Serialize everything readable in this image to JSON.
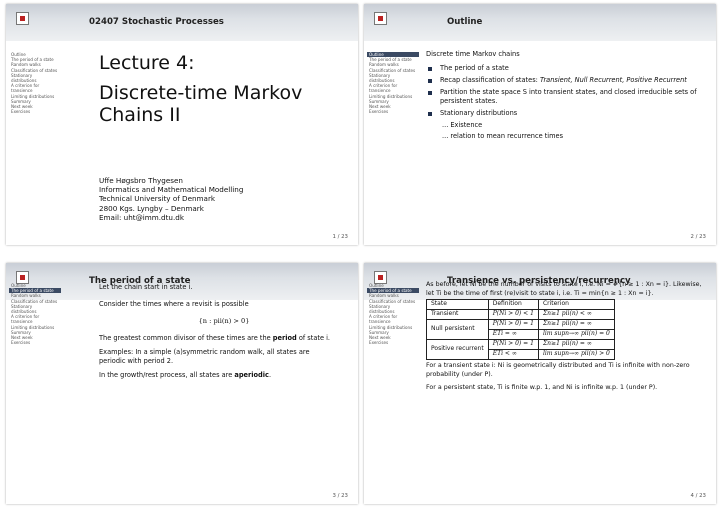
{
  "slide1": {
    "header_title": "02407 Stochastic Processes",
    "nav": [
      "Outline",
      "The period of a state",
      "Random walks",
      "Classification of states",
      "Stationary",
      "distributions",
      "A criterion for",
      "transience",
      "Limiting distributions",
      "Summary",
      "Next week",
      "Exercises"
    ],
    "title_line1": "Lecture 4:",
    "title_line2": "Discrete-time Markov Chains II",
    "author": "Uffe Høgsbro Thygesen",
    "affiliation": "Informatics and Mathematical Modelling",
    "university": "Technical University of Denmark",
    "address": "2800 Kgs. Lyngby – Denmark",
    "email": "Email: uht@imm.dtu.dk",
    "page": "1 / 23"
  },
  "slide2": {
    "header_title": "Outline",
    "nav_current": "Outline",
    "nav": [
      "The period of a state",
      "Random walks",
      "Classification of states",
      "Stationary",
      "distributions",
      "A criterion for",
      "transience",
      "Limiting distributions",
      "Summary",
      "Next week",
      "Exercises"
    ],
    "heading": "Discrete time Markov chains",
    "bullet1": "The period of a state",
    "bullet2_prefix": "Recap classification of states: ",
    "bullet2_italic": "Transient, Null Recurrent, Positive Recurrent",
    "bullet3": "Partition the state space S into transient states, and closed irreducible sets of persistent states.",
    "bullet4": "Stationary distributions",
    "sub1": "... Existence",
    "sub2": "... relation to mean recurrence times",
    "page": "2 / 23"
  },
  "slide3": {
    "header_title": "The period of a state",
    "nav_before": [
      "Outline"
    ],
    "nav_current": "The period of a state",
    "nav": [
      "Random walks",
      "Classification of states",
      "Stationary",
      "distributions",
      "A criterion for",
      "transience",
      "Limiting distributions",
      "Summary",
      "Next week",
      "Exercises"
    ],
    "p1": "Let the chain start in state i.",
    "p2": "Consider the times where a revisit is possible",
    "formula": "{n : pii(n) > 0}",
    "p3_prefix": "The greatest common divisor of these times are the ",
    "p3_bold": "period",
    "p3_suffix": " of state i.",
    "p4": "Examples: In a simple (a)symmetric random walk, all states are periodic with period 2.",
    "p5_prefix": "In the growth/rest process, all states are ",
    "p5_bold": "aperiodic",
    "p5_suffix": ".",
    "page": "3 / 23"
  },
  "slide4": {
    "header_title": "Transience vs. persistency/recurrency",
    "nav_before": [
      "Outline"
    ],
    "nav_current": "The period of a state",
    "nav": [
      "Random walks",
      "Classification of states",
      "Stationary",
      "distributions",
      "A criterion for",
      "transience",
      "Limiting distributions",
      "Summary",
      "Next week",
      "Exercises"
    ],
    "p1": "As before, let Ni be the number of visits to state i, i.e. Ni = #{n ≥ 1 : Xn = i}. Likewise, let Ti be the time of first (re)visit to state i, i.e. Ti = min{n ≥ 1 : Xn = i}.",
    "table_headers": [
      "State",
      "Definition",
      "Criterion"
    ],
    "row_transient": {
      "state": "Transient",
      "definition": "P(Ni > 0) < 1",
      "criterion": "Σn≥1 pii(n) < ∞"
    },
    "row_null": {
      "state": "Null persistent",
      "def1": "P(Ni > 0) = 1",
      "crit1": "Σn≥1 pii(n) = ∞",
      "def2": "ETi = ∞",
      "crit2": "lim supn→∞ pii(n) = 0"
    },
    "row_pos": {
      "state": "Positive recurrent",
      "def1": "P(Ni > 0) = 1",
      "crit1": "Σn≥1 pii(n) = ∞",
      "def2": "ETi < ∞",
      "crit2": "lim supn→∞ pii(n) > 0"
    },
    "p2": "For a transient state i: Ni is geometrically distributed and Ti is infinite with non-zero probability (under P).",
    "p3": "For a persistent state, Ti is finite w.p. 1, and Ni is infinite w.p. 1 (under P).",
    "page": "4 / 23"
  }
}
